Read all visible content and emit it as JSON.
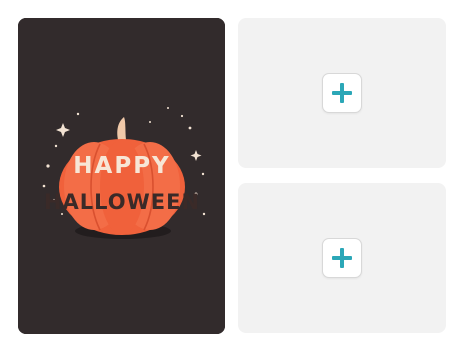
{
  "preview_card": {
    "pumpkin_text_line1": "HAPPY",
    "pumpkin_text_line2": "HALLOWEEN",
    "background_color": "#322b2c",
    "pumpkin_color": "#f0613b",
    "lettering_color": "#f7e6d6",
    "stem_color": "#f0c9a9"
  },
  "slots": [
    {
      "icon": "plus-icon",
      "accent": "#2ba7b7"
    },
    {
      "icon": "plus-icon",
      "accent": "#2ba7b7"
    }
  ]
}
